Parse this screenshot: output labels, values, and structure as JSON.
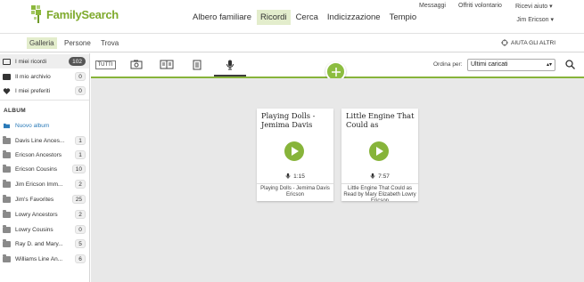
{
  "brand": {
    "name": "FamilySearch",
    "color": "#8cb83c"
  },
  "utility": {
    "messages": "Messaggi",
    "volunteer": "Offriti volontario",
    "help": "Ricevi aiuto ▾"
  },
  "nav": {
    "items": [
      "Albero familiare",
      "Ricordi",
      "Cerca",
      "Indicizzazione",
      "Tempio"
    ],
    "active": "Ricordi"
  },
  "user": {
    "name": "Jim Ericson ▾"
  },
  "subnav": {
    "tabs": [
      "Galleria",
      "Persone",
      "Trova"
    ],
    "active": "Galleria",
    "help_others": "AIUTA GLI ALTRI"
  },
  "sidebar": {
    "items": [
      {
        "label": "I miei ricordi",
        "count": "102",
        "icon": "memories-icon"
      },
      {
        "label": "Il mio archivio",
        "count": "0",
        "icon": "archive-box-icon"
      },
      {
        "label": "I miei preferiti",
        "count": "0",
        "icon": "heart-icon"
      }
    ],
    "album_heading": "ALBUM",
    "new_album": "Nuovo album",
    "albums": [
      {
        "label": "Davis Line Ances...",
        "count": "1"
      },
      {
        "label": "Ericson Ancestors",
        "count": "1"
      },
      {
        "label": "Ericson Cousins",
        "count": "10"
      },
      {
        "label": "Jim Ericson Imm...",
        "count": "2"
      },
      {
        "label": "Jim's Favorites",
        "count": "25"
      },
      {
        "label": "Lowry Ancestors",
        "count": "2"
      },
      {
        "label": "Lowry Cousins",
        "count": "0"
      },
      {
        "label": "Ray D. and Mary...",
        "count": "5"
      },
      {
        "label": "Williams Line An...",
        "count": "6"
      }
    ]
  },
  "toolbar": {
    "tabs": [
      "TUTTI",
      "photo-icon",
      "story-book-icon",
      "document-icon",
      "audio-microphone-icon"
    ],
    "active": "audio-microphone-icon",
    "sort_label": "Ordina per:",
    "sort_value": "Ultimi caricati"
  },
  "cards": [
    {
      "title": "Playing Dolls - Jemima Davis",
      "duration": "1:15",
      "caption": "Playing Dolls - Jemima Davis Ericson"
    },
    {
      "title": "Little Engine That Could as",
      "duration": "7:57",
      "caption": "Little Engine That Could as Read by Mary Elizabeth Lowry Ericson"
    }
  ],
  "colors": {
    "accent": "#87b43a",
    "active_tab": "#e3edcc",
    "gallery_bg": "#e8e8e8"
  }
}
